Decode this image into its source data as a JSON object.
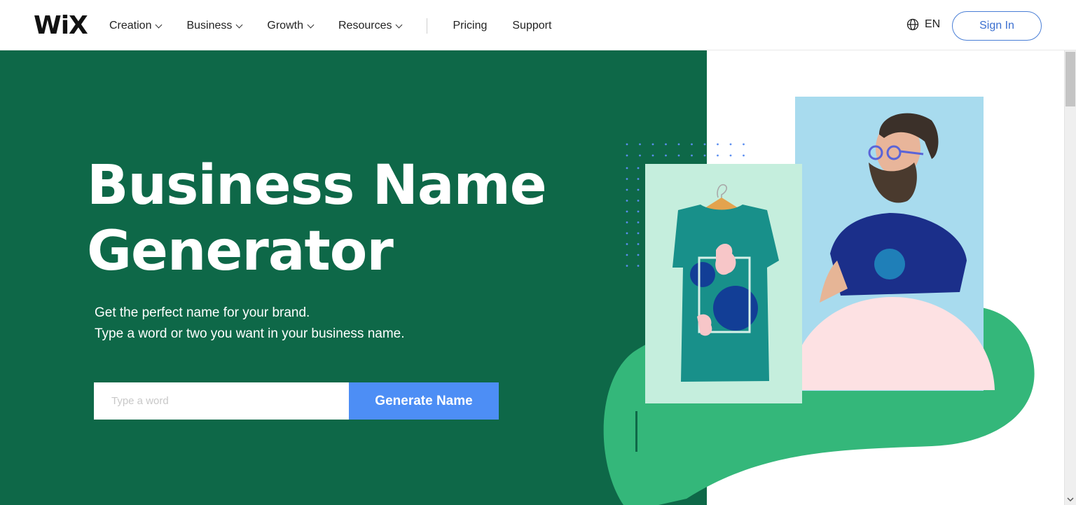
{
  "header": {
    "logo": "WiX",
    "nav": [
      {
        "label": "Creation",
        "has_dropdown": true
      },
      {
        "label": "Business",
        "has_dropdown": true
      },
      {
        "label": "Growth",
        "has_dropdown": true
      },
      {
        "label": "Resources",
        "has_dropdown": true
      },
      {
        "label": "Pricing",
        "has_dropdown": false
      },
      {
        "label": "Support",
        "has_dropdown": false
      }
    ],
    "language": {
      "icon": "globe-icon",
      "label": "EN"
    },
    "sign_in_label": "Sign In"
  },
  "hero": {
    "title_line1": "Business Name",
    "title_line2": "Generator",
    "subtitle_line1": "Get the perfect name for your brand.",
    "subtitle_line2": "Type a word or two you want in your business name.",
    "input": {
      "value": "",
      "placeholder": "Type a word"
    },
    "generate_label": "Generate Name"
  },
  "colors": {
    "hero_green": "#0e6848",
    "accent_blue": "#4d8ef5",
    "blob_green": "#34b77a",
    "mint": "#c5eedd",
    "sky": "#a8dbee",
    "pink": "#fde1e3"
  }
}
